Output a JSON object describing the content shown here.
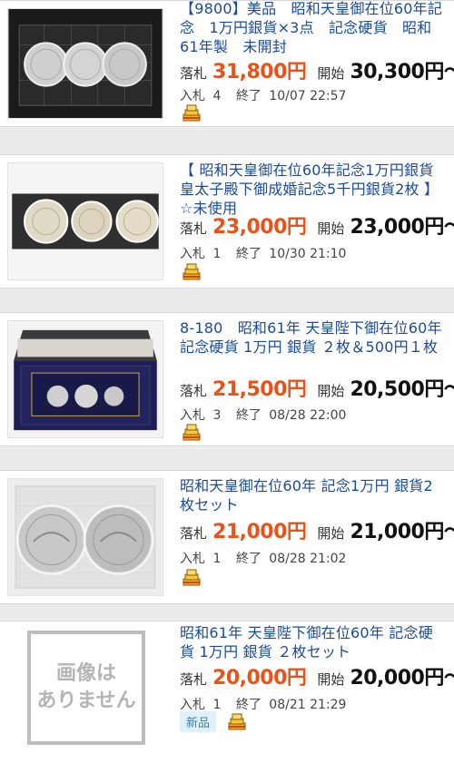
{
  "labels": {
    "win": "落札",
    "start": "開始",
    "bids": "入札",
    "end": "終了"
  },
  "items": [
    {
      "title": "【9800】美品　昭和天皇御在位60年記念　1万円銀貨×3点　記念硬貨　昭和61年製　未開封",
      "win_price": "31,800円",
      "start_price": "30,300円〜",
      "bids": "4",
      "end_time": "10/07 22:57"
    },
    {
      "title": "【 昭和天皇御在位60年記念1万円銀貨 皇太子殿下御成婚記念5千円銀貨2枚 】☆未使用",
      "win_price": "23,000円",
      "start_price": "23,000円〜",
      "bids": "1",
      "end_time": "10/30 21:10"
    },
    {
      "title": "8-180　昭和61年 天皇陛下御在位60年記念硬貨 1万円 銀貨 ２枚＆500円１枚",
      "win_price": "21,500円",
      "start_price": "20,500円〜",
      "bids": "3",
      "end_time": "08/28 22:00"
    },
    {
      "title": "昭和天皇御在位60年 記念1万円 銀貨2枚セット",
      "win_price": "21,000円",
      "start_price": "21,000円〜",
      "bids": "1",
      "end_time": "08/28 21:02"
    },
    {
      "title": "昭和61年 天皇陛下御在位60年 記念硬貨 1万円 銀貨 ２枚セット",
      "win_price": "20,000円",
      "start_price": "20,000円〜",
      "bids": "1",
      "end_time": "08/21 21:29",
      "tag": "新品",
      "no_image_line1": "画像は",
      "no_image_line2": "ありません"
    }
  ],
  "colors": {
    "title_link": "#1a4a9c",
    "win_price": "#e8531a",
    "tag_bg": "#dff1fb",
    "page_bg": "#ebebeb"
  },
  "icons": [
    "coin-stack-badge-icon"
  ]
}
